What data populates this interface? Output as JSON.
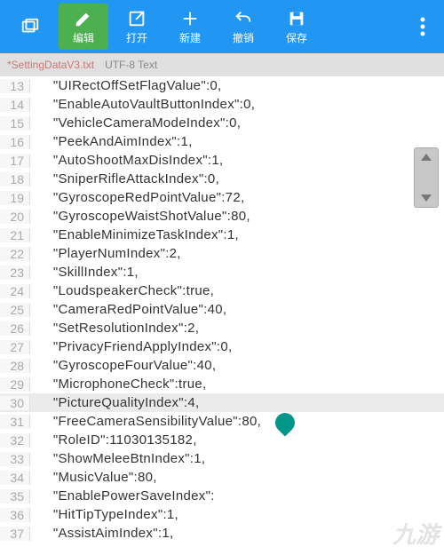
{
  "toolbar": {
    "windows": "",
    "edit": "编辑",
    "open": "打开",
    "new": "新建",
    "undo": "撤销",
    "save": "保存"
  },
  "tab": {
    "filename": "*SettingDataV3.txt",
    "encoding": "UTF-8  Text"
  },
  "lines": [
    {
      "n": "13",
      "t": "    \"UIRectOffSetFlagValue\":0,"
    },
    {
      "n": "14",
      "t": "    \"EnableAutoVaultButtonIndex\":0,"
    },
    {
      "n": "15",
      "t": "    \"VehicleCameraModeIndex\":0,"
    },
    {
      "n": "16",
      "t": "    \"PeekAndAimIndex\":1,"
    },
    {
      "n": "17",
      "t": "    \"AutoShootMaxDisIndex\":1,"
    },
    {
      "n": "18",
      "t": "    \"SniperRifleAttackIndex\":0,"
    },
    {
      "n": "19",
      "t": "    \"GyroscopeRedPointValue\":72,"
    },
    {
      "n": "20",
      "t": "    \"GyroscopeWaistShotValue\":80,"
    },
    {
      "n": "21",
      "t": "    \"EnableMinimizeTaskIndex\":1,"
    },
    {
      "n": "22",
      "t": "    \"PlayerNumIndex\":2,"
    },
    {
      "n": "23",
      "t": "    \"SkillIndex\":1,"
    },
    {
      "n": "24",
      "t": "    \"LoudspeakerCheck\":true,"
    },
    {
      "n": "25",
      "t": "    \"CameraRedPointValue\":40,"
    },
    {
      "n": "26",
      "t": "    \"SetResolutionIndex\":2,"
    },
    {
      "n": "27",
      "t": "    \"PrivacyFriendApplyIndex\":0,"
    },
    {
      "n": "28",
      "t": "    \"GyroscopeFourValue\":40,"
    },
    {
      "n": "29",
      "t": "    \"MicrophoneCheck\":true,"
    },
    {
      "n": "30",
      "t": "    \"PictureQualityIndex\":4,",
      "hl": true
    },
    {
      "n": "31",
      "t": "    \"FreeCameraSensibilityValue\":80,"
    },
    {
      "n": "32",
      "t": "    \"RoleID\":11030135182,"
    },
    {
      "n": "33",
      "t": "    \"ShowMeleeBtnIndex\":1,"
    },
    {
      "n": "34",
      "t": "    \"MusicValue\":80,"
    },
    {
      "n": "35",
      "t": "    \"EnablePowerSaveIndex\":"
    },
    {
      "n": "36",
      "t": "    \"HitTipTypeIndex\":1,"
    },
    {
      "n": "37",
      "t": "    \"AssistAimIndex\":1,"
    }
  ],
  "watermark": "九游"
}
